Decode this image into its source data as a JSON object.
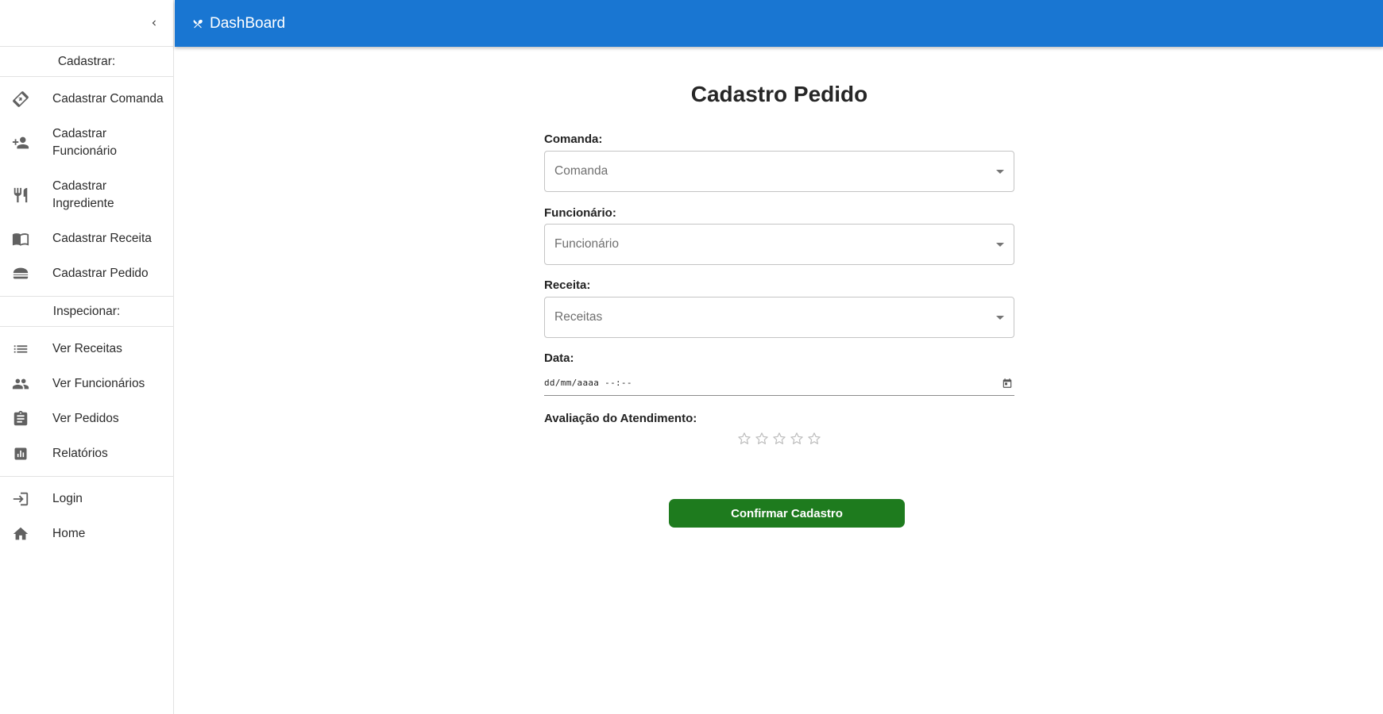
{
  "appbar": {
    "title": "DashBoard"
  },
  "sidebar": {
    "sections": [
      {
        "title": "Cadastrar:",
        "items": [
          {
            "label": "Cadastrar Comanda",
            "icon": "phone-forward-icon"
          },
          {
            "label": "Cadastrar Funcionário",
            "icon": "person-add-icon"
          },
          {
            "label": "Cadastrar Ingrediente",
            "icon": "restaurant-icon"
          },
          {
            "label": "Cadastrar Receita",
            "icon": "menu-book-icon"
          },
          {
            "label": "Cadastrar Pedido",
            "icon": "burger-icon"
          }
        ]
      },
      {
        "title": "Inspecionar:",
        "items": [
          {
            "label": "Ver Receitas",
            "icon": "list-icon"
          },
          {
            "label": "Ver Funcionários",
            "icon": "people-icon"
          },
          {
            "label": "Ver Pedidos",
            "icon": "clipboard-icon"
          },
          {
            "label": "Relatórios",
            "icon": "bar-chart-icon"
          }
        ]
      }
    ],
    "footer_items": [
      {
        "label": "Login",
        "icon": "login-icon"
      },
      {
        "label": "Home",
        "icon": "home-icon"
      }
    ]
  },
  "form": {
    "title": "Cadastro Pedido",
    "comanda": {
      "label": "Comanda:",
      "placeholder": "Comanda"
    },
    "funcionario": {
      "label": "Funcionário:",
      "placeholder": "Funcionário"
    },
    "receita": {
      "label": "Receita:",
      "placeholder": "Receitas"
    },
    "data": {
      "label": "Data:",
      "value": "dd/mm/aaaa --:--"
    },
    "avaliacao": {
      "label": "Avaliação do Atendimento:",
      "rating": 0,
      "max": 5
    },
    "submit_label": "Confirmar Cadastro"
  },
  "colors": {
    "appbar": "#1976d2",
    "submit": "#1e7b1e",
    "icon": "#616161",
    "star": "#bdbdbd"
  }
}
